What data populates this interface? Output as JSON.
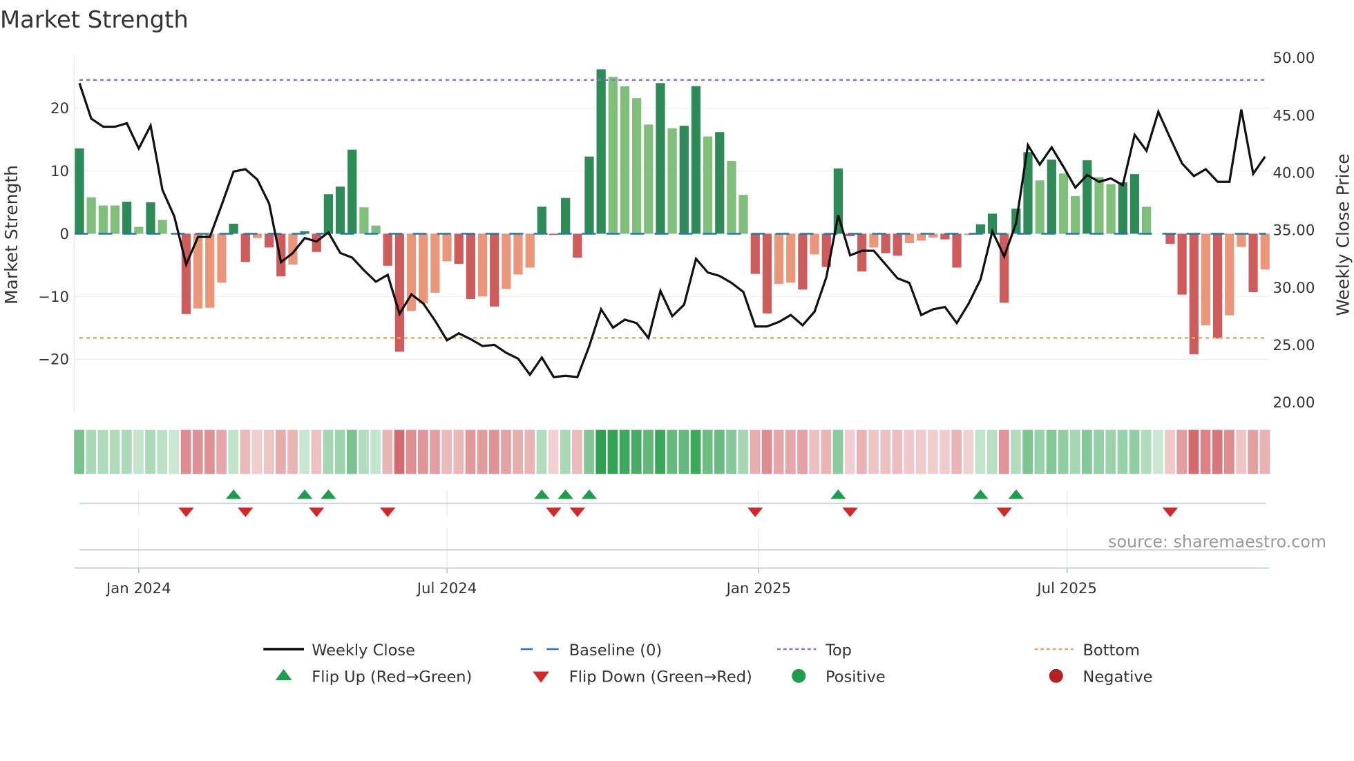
{
  "title": "Market Strength",
  "source": "source: sharemaestro.com",
  "chart_data": {
    "type": "bar+line",
    "x_unit": "week index (week 0 = 2023-11-27)",
    "strength": [
      13.6,
      5.8,
      4.5,
      4.5,
      5.1,
      1.1,
      5.0,
      2.2,
      0,
      -12.8,
      -11.9,
      -11.8,
      -7.8,
      1.6,
      -4.5,
      -0.7,
      -2.2,
      -6.8,
      -4.9,
      0.4,
      -2.9,
      6.3,
      7.5,
      13.4,
      4.2,
      1.3,
      -5.1,
      -18.8,
      -12.3,
      -11.1,
      -9.4,
      -4.4,
      -4.8,
      -10.4,
      -10.0,
      -11.6,
      -8.8,
      -6.5,
      -5.4,
      4.3,
      -0.2,
      5.7,
      -3.8,
      12.3,
      26.2,
      25.0,
      23.5,
      21.6,
      17.4,
      24.0,
      16.8,
      17.2,
      23.5,
      15.5,
      16.2,
      11.6,
      6.2,
      -6.4,
      -12.7,
      -8.0,
      -7.8,
      -8.9,
      -3.3,
      -5.3,
      10.4,
      -0.4,
      -6.0,
      -2.2,
      -3.1,
      -3.5,
      -1.5,
      -1.1,
      -0.6,
      -0.9,
      -5.4,
      -0.2,
      1.5,
      3.2,
      -11.0,
      4.0,
      13.0,
      8.5,
      11.8,
      9.6,
      6.0,
      11.7,
      9.0,
      7.9,
      8.2,
      9.5,
      4.3,
      0,
      -1.6,
      -9.7,
      -19.2,
      -14.6,
      -16.7,
      -13.0,
      -2.1,
      -9.3,
      -5.7
    ],
    "close": [
      47.8,
      44.7,
      44.0,
      44.0,
      44.3,
      42.1,
      44.1,
      38.5,
      36.2,
      32.0,
      34.4,
      34.4,
      37.2,
      40.1,
      40.3,
      39.4,
      37.3,
      32.2,
      33.0,
      34.3,
      34.0,
      34.8,
      33.0,
      32.6,
      31.5,
      30.5,
      31.1,
      27.7,
      29.4,
      28.6,
      27.1,
      25.4,
      26.0,
      25.5,
      24.9,
      25.0,
      24.3,
      23.8,
      22.4,
      23.9,
      22.2,
      22.3,
      22.2,
      24.9,
      28.1,
      26.5,
      27.2,
      26.9,
      25.6,
      29.7,
      27.5,
      28.5,
      32.5,
      31.3,
      31.0,
      30.4,
      29.6,
      26.6,
      26.6,
      27.0,
      27.6,
      26.7,
      27.9,
      30.9,
      36.3,
      32.8,
      33.2,
      33.2,
      32.0,
      30.8,
      30.4,
      27.6,
      28.1,
      28.3,
      26.9,
      28.6,
      30.7,
      34.9,
      32.7,
      35.6,
      42.4,
      40.7,
      42.2,
      40.5,
      38.7,
      39.8,
      39.2,
      39.5,
      38.9,
      43.3,
      41.9,
      45.3,
      43.0,
      40.8,
      39.7,
      40.3,
      39.2,
      39.2,
      45.5,
      39.9,
      41.4
    ],
    "ylabel_left": "Market Strength",
    "ylabel_right": "Weekly Close Price",
    "left_range": [
      -28.5,
      28.3
    ],
    "right_range": [
      19.1,
      50.15
    ],
    "left_ticks": [
      {
        "v": 20,
        "label": "20"
      },
      {
        "v": 10,
        "label": "10"
      },
      {
        "v": 0,
        "label": "0"
      },
      {
        "v": -10,
        "label": "−10"
      },
      {
        "v": -20,
        "label": "−20"
      }
    ],
    "right_ticks": [
      {
        "v": 50,
        "label": "50.00"
      },
      {
        "v": 45,
        "label": "45.00"
      },
      {
        "v": 40,
        "label": "40.00"
      },
      {
        "v": 35,
        "label": "35.00"
      },
      {
        "v": 30,
        "label": "30.00"
      },
      {
        "v": 25,
        "label": "25.00"
      },
      {
        "v": 20,
        "label": "20.00"
      }
    ],
    "x_ticks": [
      {
        "week": 5,
        "label": "Jan 2024"
      },
      {
        "week": 31,
        "label": "Jul 2024"
      },
      {
        "week": 57.3,
        "label": "Jan 2025"
      },
      {
        "week": 83.3,
        "label": "Jul 2025"
      }
    ],
    "top_level": 24.5,
    "bottom_level": -16.6,
    "baseline": 0,
    "grid": true,
    "legend_position": "bottom",
    "legend": [
      {
        "label": "Weekly Close",
        "kind": "line"
      },
      {
        "label": "Baseline (0)",
        "kind": "baseline"
      },
      {
        "label": "Top",
        "kind": "top"
      },
      {
        "label": "Bottom",
        "kind": "bottom"
      },
      {
        "label": "Flip Up (Red→Green)",
        "kind": "up"
      },
      {
        "label": "Flip Down (Green→Red)",
        "kind": "down"
      },
      {
        "label": "Positive",
        "kind": "pos"
      },
      {
        "label": "Negative",
        "kind": "neg"
      }
    ],
    "colors": {
      "green_dark": "#2e8b57",
      "green_light": "#7fbf7b",
      "red_dark": "#cd5c5c",
      "red_light": "#e9967a",
      "baseline": "#1f77b4",
      "top": "#9370db",
      "bottom": "#f4a460",
      "line": "#111111",
      "flip_up": "#1e9e4a",
      "flip_down": "#d62728",
      "positive": "#1e9e4a",
      "negative": "#b22222"
    }
  }
}
